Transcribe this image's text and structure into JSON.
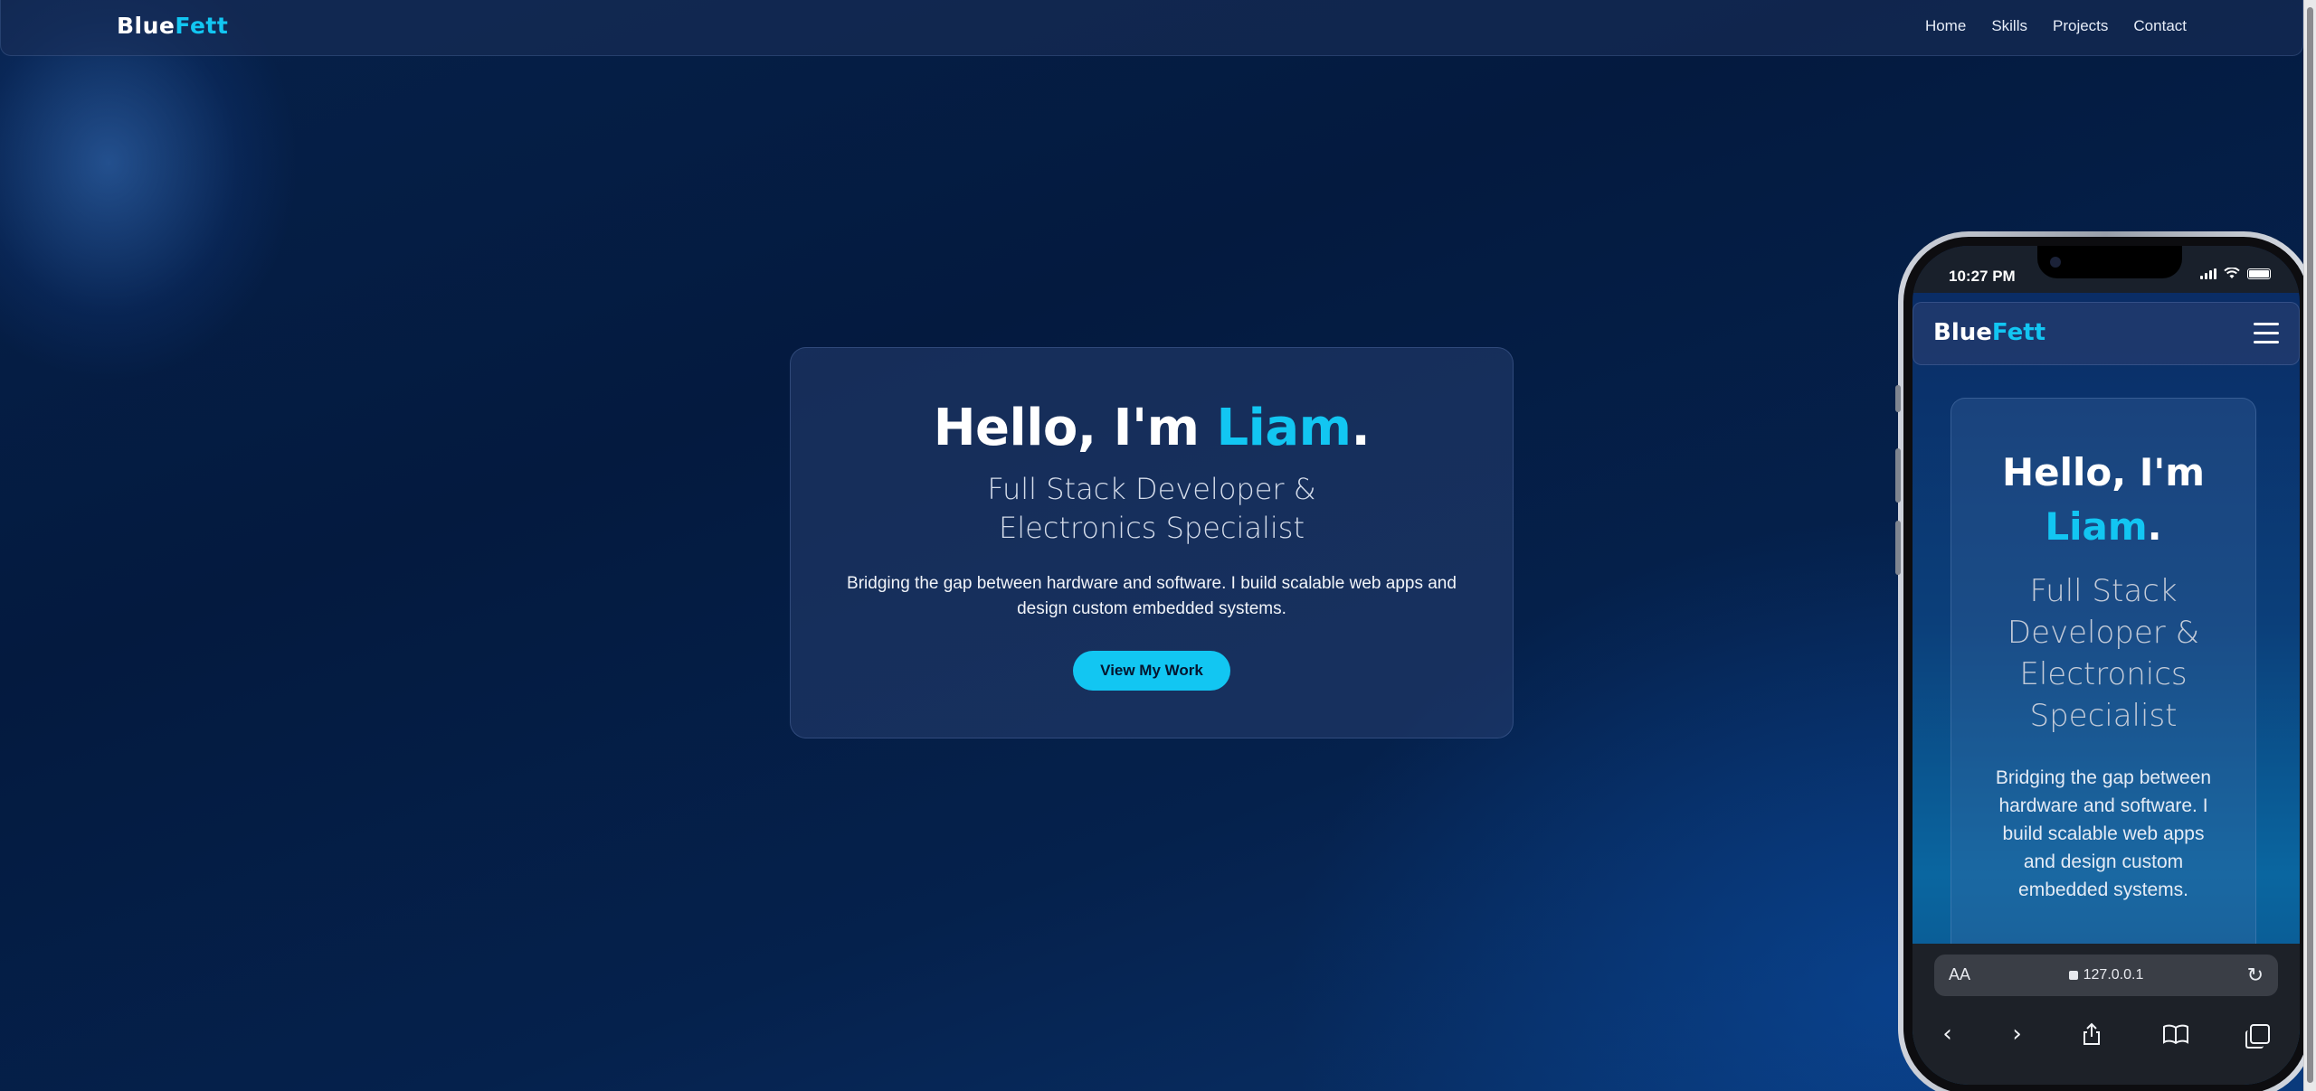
{
  "site": {
    "brand_part1": "Blue",
    "brand_part2": "Fett"
  },
  "nav": {
    "items": [
      {
        "label": "Home"
      },
      {
        "label": "Skills"
      },
      {
        "label": "Projects"
      },
      {
        "label": "Contact"
      }
    ]
  },
  "hero": {
    "greeting": "Hello, I'm ",
    "name": "Liam",
    "punct": ".",
    "subtitle_line1": "Full Stack Developer &",
    "subtitle_line2": "Electronics Specialist",
    "description": "Bridging the gap between hardware and software. I build scalable web apps and design custom embedded systems.",
    "cta_label": "View My Work"
  },
  "mobile": {
    "status_time": "10:27 PM",
    "greeting": "Hello, I'm",
    "name": "Liam",
    "punct": ".",
    "subtitle": "Full Stack Developer & Electronics Specialist",
    "description": "Bridging the gap between hardware and software. I build scalable web apps and design custom embedded systems.",
    "text_size_label": "AA",
    "url": "127.0.0.1"
  },
  "colors": {
    "accent": "#12c6f2",
    "background": "#041a3d",
    "card": "#263e70"
  },
  "icons": {
    "mobile_menu": "hamburger-icon",
    "reload": "reload-icon",
    "back": "chevron-left-icon",
    "forward": "chevron-right-icon",
    "share": "share-icon",
    "bookmarks": "book-icon",
    "tabs": "tabs-icon"
  }
}
